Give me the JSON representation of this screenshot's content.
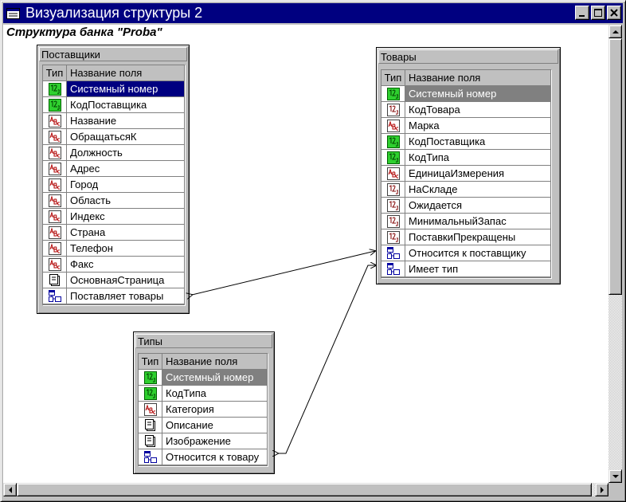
{
  "window": {
    "title": "Визуализация структуры 2",
    "buttons": {
      "minimize": "minimize-icon",
      "maximize": "maximize-icon",
      "close": "close-icon"
    }
  },
  "diagram": {
    "title": "Структура банка \"Proba\""
  },
  "header": {
    "type_label": "Тип",
    "name_label": "Название поля"
  },
  "tables": {
    "suppliers": {
      "name": "Поставщики",
      "fields": [
        {
          "name": "Системный номер",
          "type": "number"
        },
        {
          "name": "КодПоставщика",
          "type": "number"
        },
        {
          "name": "Название",
          "type": "text"
        },
        {
          "name": "ОбращатьсяК",
          "type": "text"
        },
        {
          "name": "Должность",
          "type": "text"
        },
        {
          "name": "Адрес",
          "type": "text"
        },
        {
          "name": "Город",
          "type": "text"
        },
        {
          "name": "Область",
          "type": "text"
        },
        {
          "name": "Индекс",
          "type": "text"
        },
        {
          "name": "Страна",
          "type": "text"
        },
        {
          "name": "Телефон",
          "type": "text"
        },
        {
          "name": "Факс",
          "type": "text"
        },
        {
          "name": "ОсновнаяСтраница",
          "type": "memo"
        },
        {
          "name": "Поставляет товары",
          "type": "link"
        }
      ]
    },
    "goods": {
      "name": "Товары",
      "fields": [
        {
          "name": "Системный номер",
          "type": "number"
        },
        {
          "name": "КодТовара",
          "type": "number-white"
        },
        {
          "name": "Марка",
          "type": "text"
        },
        {
          "name": "КодПоставщика",
          "type": "number"
        },
        {
          "name": "КодТипа",
          "type": "number"
        },
        {
          "name": "ЕдиницаИзмерения",
          "type": "text"
        },
        {
          "name": "НаСкладе",
          "type": "number-white"
        },
        {
          "name": "Ожидается",
          "type": "number-white"
        },
        {
          "name": "МинимальныйЗапас",
          "type": "number-white"
        },
        {
          "name": "ПоставкиПрекращены",
          "type": "number-white"
        },
        {
          "name": "Относится к поставщику",
          "type": "link"
        },
        {
          "name": "Имеет тип",
          "type": "link"
        }
      ]
    },
    "types": {
      "name": "Типы",
      "fields": [
        {
          "name": "Системный номер",
          "type": "number"
        },
        {
          "name": "КодТипа",
          "type": "number"
        },
        {
          "name": "Категория",
          "type": "text"
        },
        {
          "name": "Описание",
          "type": "memo"
        },
        {
          "name": "Изображение",
          "type": "memo"
        },
        {
          "name": "Относится к товару",
          "type": "link"
        }
      ]
    }
  },
  "icons": {
    "number": "numeric-field-icon",
    "number-white": "numeric-field-icon",
    "text": "text-field-icon",
    "memo": "memo-field-icon",
    "link": "relation-field-icon"
  },
  "colors": {
    "titlebar": "#000080",
    "selection": "#000080",
    "selection_inactive": "#808080",
    "numeric_icon": "#2fd02f"
  }
}
